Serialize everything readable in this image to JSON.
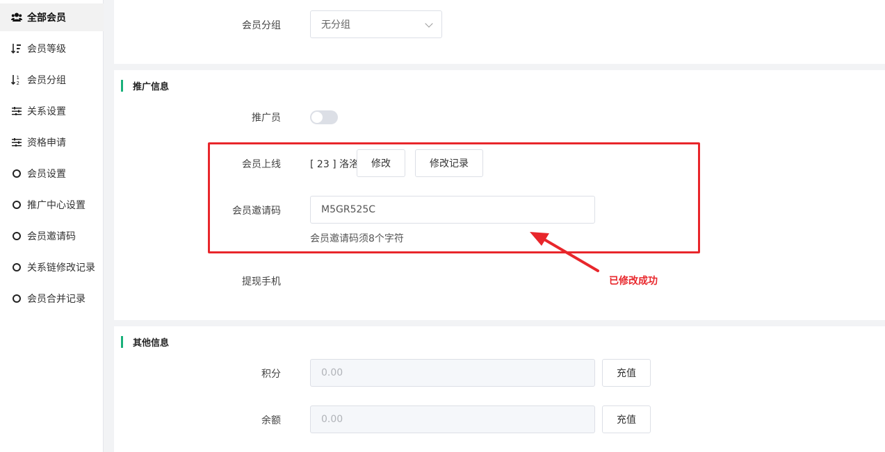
{
  "sidebar": {
    "items": [
      {
        "label": "全部会员",
        "icon": "users-icon",
        "active": true
      },
      {
        "label": "会员等级",
        "icon": "sort-level-icon"
      },
      {
        "label": "会员分组",
        "icon": "sort-group-icon"
      },
      {
        "label": "关系设置",
        "icon": "sliders-icon"
      },
      {
        "label": "资格申请",
        "icon": "sliders-icon"
      },
      {
        "label": "会员设置",
        "icon": "circle-icon"
      },
      {
        "label": "推广中心设置",
        "icon": "circle-icon"
      },
      {
        "label": "会员邀请码",
        "icon": "circle-icon"
      },
      {
        "label": "关系链修改记录",
        "icon": "circle-icon"
      },
      {
        "label": "会员合并记录",
        "icon": "circle-icon"
      }
    ]
  },
  "basic": {
    "group_label": "会员分组",
    "group_value": "无分组"
  },
  "promo": {
    "title": "推广信息",
    "promoter_label": "推广员",
    "promoter_enabled": false,
    "upline_label": "会员上线",
    "upline_value": "[ 23 ] 洛洛",
    "modify_button": "修改",
    "modify_log_button": "修改记录",
    "invite_code_label": "会员邀请码",
    "invite_code_value": "M5GR525C",
    "invite_code_hint": "会员邀请码须8个字符",
    "withdraw_phone_label": "提现手机"
  },
  "other": {
    "title": "其他信息",
    "points_label": "积分",
    "points_value": "0.00",
    "balance_label": "余额",
    "balance_value": "0.00",
    "recharge_button": "充值"
  },
  "annotation": {
    "text": "已修改成功",
    "color": "#e8262b"
  },
  "colors": {
    "accent": "#19b07a",
    "annotation": "#e8262b"
  }
}
